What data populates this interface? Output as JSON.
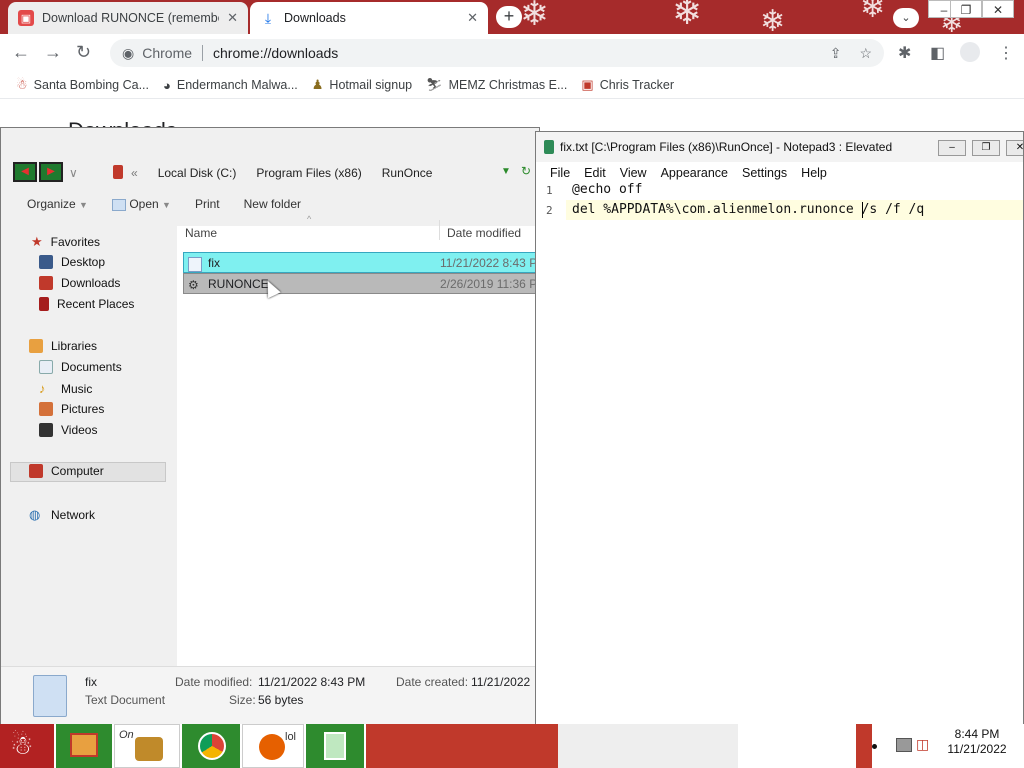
{
  "chrome": {
    "tabs": [
      {
        "title": "Download RUNONCE (remembe",
        "icon": "folder-red-icon"
      },
      {
        "title": "Downloads",
        "icon": "download-icon"
      }
    ],
    "new_tab": "+",
    "omnibox": {
      "scheme_label": "Chrome",
      "url": "chrome://downloads"
    },
    "bookmarks": [
      {
        "label": "Santa Bombing Ca..."
      },
      {
        "label": "Endermanch Malwa..."
      },
      {
        "label": "Hotmail signup"
      },
      {
        "label": "MEMZ Christmas E..."
      },
      {
        "label": "Chris Tracker"
      }
    ],
    "page_title": "Downloads"
  },
  "explorer": {
    "breadcrumb": [
      "Local Disk (C:)",
      "Program Files (x86)",
      "RunOnce"
    ],
    "commands": [
      "Organize",
      "Open",
      "Print",
      "New folder"
    ],
    "nav": {
      "favorites": "Favorites",
      "favorites_items": [
        "Desktop",
        "Downloads",
        "Recent Places"
      ],
      "libraries": "Libraries",
      "libraries_items": [
        "Documents",
        "Music",
        "Pictures",
        "Videos"
      ],
      "computer": "Computer",
      "network": "Network"
    },
    "columns": {
      "name": "Name",
      "date": "Date modified"
    },
    "files": [
      {
        "name": "fix",
        "date": "11/21/2022 8:43 P"
      },
      {
        "name": "RUNONCE",
        "date": "2/26/2019 11:36 P"
      }
    ],
    "details": {
      "name": "fix",
      "type": "Text Document",
      "modified_label": "Date modified:",
      "modified": "11/21/2022 8:43 PM",
      "size_label": "Size:",
      "size": "56 bytes",
      "created_label": "Date created:",
      "created": "11/21/2022"
    }
  },
  "notepad": {
    "title": "fix.txt [C:\\Program Files (x86)\\RunOnce] - Notepad3 : Elevated",
    "menu": [
      "File",
      "Edit",
      "View",
      "Appearance",
      "Settings",
      "Help"
    ],
    "lines": [
      {
        "num": "1",
        "text": "@echo off"
      },
      {
        "num": "2",
        "text": "del %APPDATA%\\com.alienmelon.runonce /s /f /q"
      }
    ]
  },
  "taskbar": {
    "clock_time": "8:44 PM",
    "clock_date": "11/21/2022",
    "partial_labels": [
      "On",
      "lol"
    ]
  },
  "colors": {
    "tab_strip": "#a62b2b",
    "selection": "#7ff0f0",
    "taskbar_green": "#2e8b2e",
    "taskbar_red": "#c0392b"
  }
}
